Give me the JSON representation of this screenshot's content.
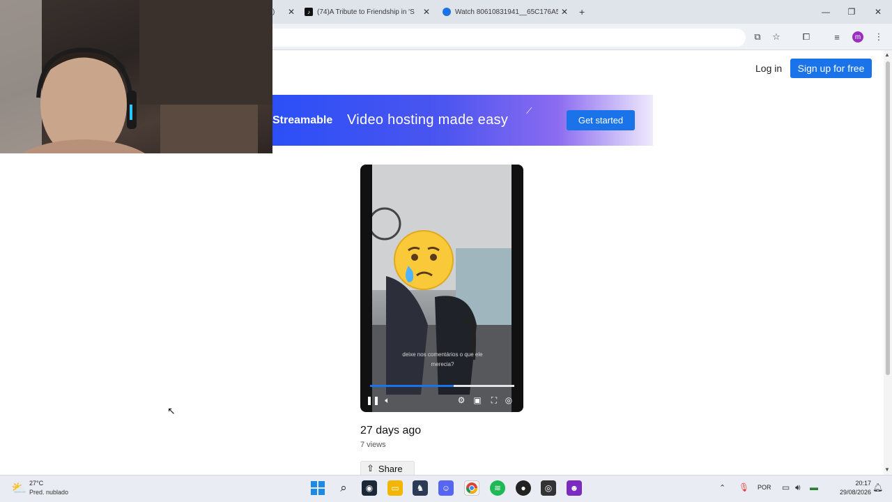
{
  "browser": {
    "tabs": [
      {
        "label": "(74)A Tribute to Friendship in 'S",
        "icon": "tiktok-icon"
      },
      {
        "label": "Watch 80610831941__65C176A5",
        "icon": "streamable-icon"
      }
    ],
    "new_tab_symbol": "+",
    "toolbar_icons": [
      "translate-icon",
      "star-icon",
      "extensions-icon",
      "media-control-icon",
      "profile-avatar-icon",
      "more-menu-icon"
    ],
    "profile_initial": "m"
  },
  "header": {
    "login_label": "Log in",
    "signup_label": "Sign up for free"
  },
  "banner": {
    "logo_text": "Streamable",
    "headline": "Video hosting made easy",
    "cta_label": "Get started"
  },
  "video": {
    "subtitle_line1": "deixe nos comentários o que  ele",
    "subtitle_line2": "merecia?",
    "progress": 0.58,
    "emoji": "crying-face"
  },
  "meta": {
    "date": "27 days ago",
    "views": "7 views",
    "share_label": "Share"
  },
  "taskbar": {
    "weather_temp": "27°C",
    "weather_desc": "Pred. nublado",
    "language": "POR",
    "time": "20:17",
    "date": "29/08/2026"
  },
  "colors": {
    "accent": "#1a73e8",
    "banner_start": "#2b4ff7",
    "banner_end": "#efeafc"
  }
}
